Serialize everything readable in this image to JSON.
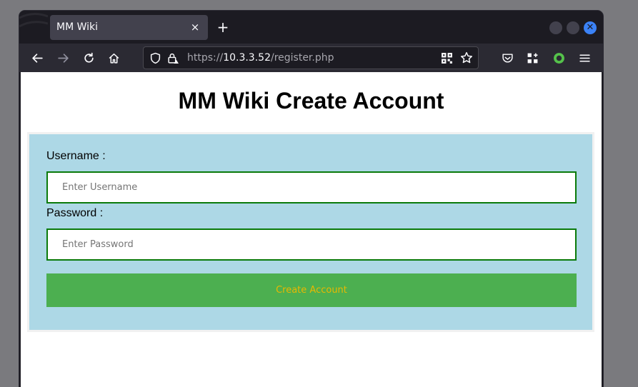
{
  "browser": {
    "tab_title": "MM Wiki",
    "tab_close": "×",
    "new_tab": "+",
    "url_scheme": "https://",
    "url_host": "10.3.3.52",
    "url_path": "/register.php"
  },
  "page": {
    "title": "MM Wiki Create Account",
    "username_label": "Username :",
    "username_placeholder": "Enter Username",
    "password_label": "Password :",
    "password_placeholder": "Enter Password",
    "submit_label": "Create Account"
  },
  "colors": {
    "form_background": "#add8e6",
    "input_border": "#0a7a0a",
    "button_background": "#4caf50",
    "button_text": "#e8b800",
    "close_button": "#3b82f6"
  },
  "icons": [
    "back-arrow-icon",
    "forward-arrow-icon",
    "reload-icon",
    "home-icon",
    "shield-icon",
    "lock-warning-icon",
    "qr-code-icon",
    "star-icon",
    "pocket-icon",
    "extensions-icon",
    "extension-green-icon",
    "menu-icon",
    "close-icon",
    "plus-icon"
  ]
}
